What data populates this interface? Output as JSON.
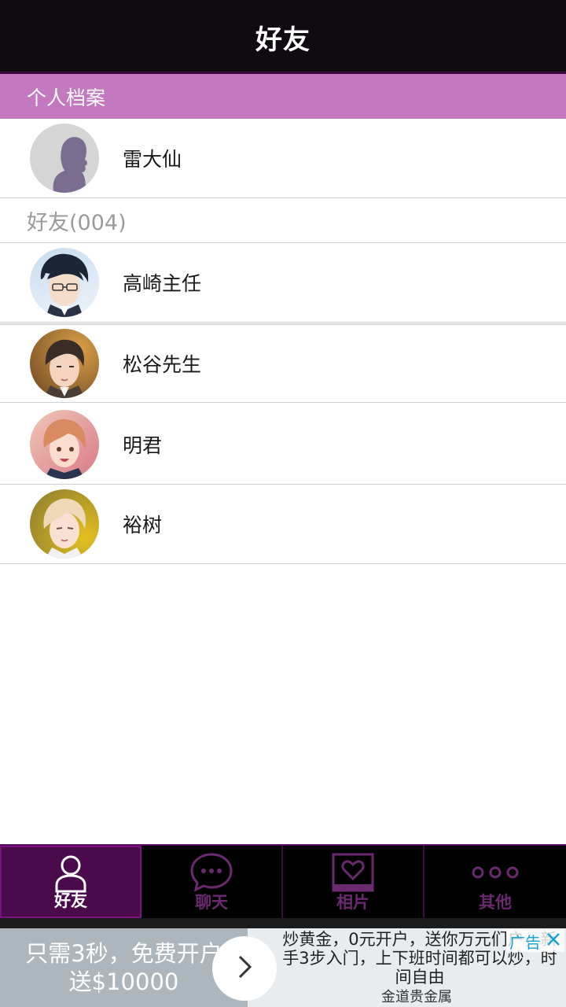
{
  "header": {
    "title": "好友"
  },
  "profile_section": {
    "label": "个人档案"
  },
  "profile": {
    "name": "雷大仙"
  },
  "friends_group": {
    "label": "好友(004)"
  },
  "friends": [
    {
      "name": "高崎主任",
      "avatar": "avatar-takasaki"
    },
    {
      "name": "松谷先生",
      "avatar": "avatar-matsutani"
    },
    {
      "name": "明君",
      "avatar": "avatar-akira"
    },
    {
      "name": "裕树",
      "avatar": "avatar-yuki"
    }
  ],
  "tabs": [
    {
      "label": "好友",
      "icon": "person-icon",
      "active": true
    },
    {
      "label": "聊天",
      "icon": "chat-bubble-icon",
      "active": false
    },
    {
      "label": "相片",
      "icon": "heart-photo-icon",
      "active": false
    },
    {
      "label": "其他",
      "icon": "more-dots-icon",
      "active": false
    }
  ],
  "ad": {
    "left_text": "只需3秒，免费开户送$10000",
    "headline": "炒黄金，0元开户，送你万元们户，新手3步入门，上下班时间都可以炒，时间自由",
    "brand": "金道贵金属",
    "tag": "广告",
    "accent": "#12a3d8"
  },
  "colors": {
    "header_bg": "#100b10",
    "section_bg": "#c478c0",
    "tab_active_bg": "#4a0a4c"
  }
}
